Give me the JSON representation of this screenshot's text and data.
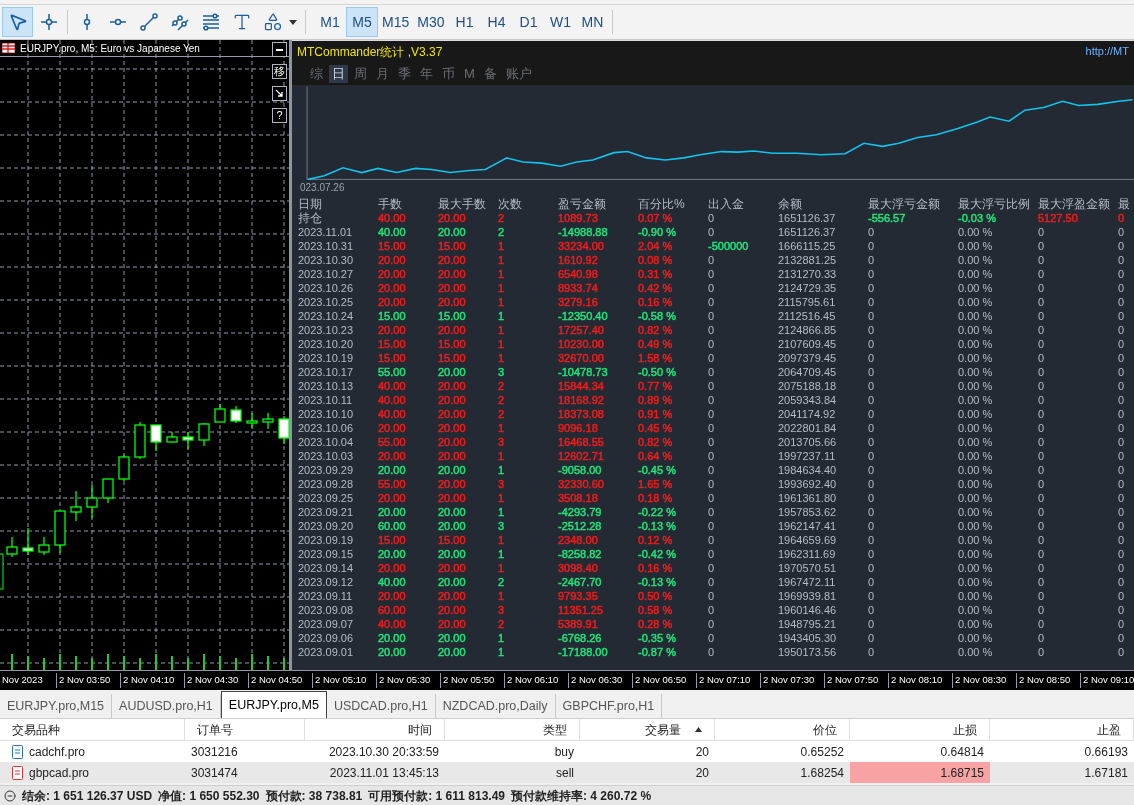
{
  "toolbar": {
    "drawing_tools": [
      {
        "kind": "cursor",
        "selected": true
      },
      {
        "kind": "crosshair",
        "selected": false
      },
      {
        "kind": "vertical_line",
        "selected": false
      },
      {
        "kind": "horizontal_line",
        "selected": false
      },
      {
        "kind": "trendline",
        "selected": false
      },
      {
        "kind": "channel",
        "selected": false
      },
      {
        "kind": "fibonacci",
        "selected": false
      },
      {
        "kind": "text",
        "selected": false
      },
      {
        "kind": "shapes",
        "selected": false
      }
    ],
    "timeframes": [
      {
        "label": "M1",
        "selected": false
      },
      {
        "label": "M5",
        "selected": true
      },
      {
        "label": "M15",
        "selected": false
      },
      {
        "label": "M30",
        "selected": false
      },
      {
        "label": "H1",
        "selected": false
      },
      {
        "label": "H4",
        "selected": false
      },
      {
        "label": "D1",
        "selected": false
      },
      {
        "label": "W1",
        "selected": false
      },
      {
        "label": "MN",
        "selected": false
      }
    ]
  },
  "chart_window": {
    "title": "EURJPY.pro, M5:  Euro vs Japanese Yen",
    "side_buttons": [
      {
        "kind": "minimize"
      },
      {
        "kind": "text",
        "label": "移"
      },
      {
        "kind": "arrow"
      },
      {
        "kind": "text",
        "label": "?"
      }
    ]
  },
  "commander": {
    "title": "MTCommander统计 ,V3.37",
    "link": "http://MT",
    "periods": [
      {
        "label": "综",
        "selected": false
      },
      {
        "label": "日",
        "selected": true
      },
      {
        "label": "周",
        "selected": false
      },
      {
        "label": "月",
        "selected": false
      },
      {
        "label": "季",
        "selected": false
      },
      {
        "label": "年",
        "selected": false
      },
      {
        "label": "币",
        "selected": false
      },
      {
        "label": "M",
        "selected": false
      },
      {
        "label": "备",
        "selected": false
      },
      {
        "label": "账户",
        "selected": false
      }
    ],
    "equity_chart": {
      "start_label": "023.07.26"
    },
    "columns": [
      "日期",
      "手数",
      "最大手数",
      "次数",
      "盈亏金额",
      "百分比%",
      "出入金",
      "余额",
      "最大浮亏金额",
      "最大浮亏比例",
      "最大浮盈金额",
      "最"
    ],
    "rows": [
      {
        "date": "持仓",
        "lots": "40.00",
        "max_lots": "20.00",
        "count": "2",
        "pnl": "1089.73",
        "pct": "0.07 %",
        "flow": "0",
        "balance": "1651126.37",
        "max_float_loss": {
          "text": "-556.57",
          "color": "#1ee37a"
        },
        "max_float_loss_pct": {
          "text": "-0.03 %",
          "color": "#1ee37a"
        },
        "max_float_profit": {
          "text": "5127.50",
          "color": "#f01c1c"
        },
        "column_12": {
          "text": "0",
          "color": "#f01c1c"
        },
        "color": "#f01c1c"
      },
      {
        "date": "2023.11.01",
        "lots": "40.00",
        "max_lots": "20.00",
        "count": "2",
        "pnl": "-14988.88",
        "pct": "-0.90 %",
        "flow": "0",
        "balance": "1651126.37",
        "max_float_loss": "0",
        "max_float_loss_pct": "0.00 %",
        "max_float_profit": "0",
        "column_12": "0",
        "color": "#1ee37a"
      },
      {
        "date": "2023.10.31",
        "lots": "15.00",
        "max_lots": "15.00",
        "count": "1",
        "pnl": "33234.00",
        "pct": "2.04 %",
        "flow": {
          "text": "-500000",
          "color": "#1ee37a"
        },
        "balance": "1666115.25",
        "max_float_loss": "0",
        "max_float_loss_pct": "0.00 %",
        "max_float_profit": "0",
        "column_12": "0",
        "color": "#f01c1c"
      },
      {
        "date": "2023.10.30",
        "lots": "20.00",
        "max_lots": "20.00",
        "count": "1",
        "pnl": "1610.92",
        "pct": "0.08 %",
        "flow": "0",
        "balance": "2132881.25",
        "max_float_loss": "0",
        "max_float_loss_pct": "0.00 %",
        "max_float_profit": "0",
        "column_12": "0",
        "color": "#f01c1c"
      },
      {
        "date": "2023.10.27",
        "lots": "20.00",
        "max_lots": "20.00",
        "count": "1",
        "pnl": "6540.98",
        "pct": "0.31 %",
        "flow": "0",
        "balance": "2131270.33",
        "max_float_loss": "0",
        "max_float_loss_pct": "0.00 %",
        "max_float_profit": "0",
        "column_12": "0",
        "color": "#f01c1c"
      },
      {
        "date": "2023.10.26",
        "lots": "20.00",
        "max_lots": "20.00",
        "count": "1",
        "pnl": "8933.74",
        "pct": "0.42 %",
        "flow": "0",
        "balance": "2124729.35",
        "max_float_loss": "0",
        "max_float_loss_pct": "0.00 %",
        "max_float_profit": "0",
        "column_12": "0",
        "color": "#f01c1c"
      },
      {
        "date": "2023.10.25",
        "lots": "20.00",
        "max_lots": "20.00",
        "count": "1",
        "pnl": "3279.16",
        "pct": "0.16 %",
        "flow": "0",
        "balance": "2115795.61",
        "max_float_loss": "0",
        "max_float_loss_pct": "0.00 %",
        "max_float_profit": "0",
        "column_12": "0",
        "color": "#f01c1c"
      },
      {
        "date": "2023.10.24",
        "lots": "15.00",
        "max_lots": "15.00",
        "count": "1",
        "pnl": "-12350.40",
        "pct": "-0.58 %",
        "flow": "0",
        "balance": "2112516.45",
        "max_float_loss": "0",
        "max_float_loss_pct": "0.00 %",
        "max_float_profit": "0",
        "column_12": "0",
        "color": "#1ee37a"
      },
      {
        "date": "2023.10.23",
        "lots": "20.00",
        "max_lots": "20.00",
        "count": "1",
        "pnl": "17257.40",
        "pct": "0.82 %",
        "flow": "0",
        "balance": "2124866.85",
        "max_float_loss": "0",
        "max_float_loss_pct": "0.00 %",
        "max_float_profit": "0",
        "column_12": "0",
        "color": "#f01c1c"
      },
      {
        "date": "2023.10.20",
        "lots": "15.00",
        "max_lots": "15.00",
        "count": "1",
        "pnl": "10230.00",
        "pct": "0.49 %",
        "flow": "0",
        "balance": "2107609.45",
        "max_float_loss": "0",
        "max_float_loss_pct": "0.00 %",
        "max_float_profit": "0",
        "column_12": "0",
        "color": "#f01c1c"
      },
      {
        "date": "2023.10.19",
        "lots": "15.00",
        "max_lots": "15.00",
        "count": "1",
        "pnl": "32670.00",
        "pct": "1.58 %",
        "flow": "0",
        "balance": "2097379.45",
        "max_float_loss": "0",
        "max_float_loss_pct": "0.00 %",
        "max_float_profit": "0",
        "column_12": "0",
        "color": "#f01c1c"
      },
      {
        "date": "2023.10.17",
        "lots": "55.00",
        "max_lots": "20.00",
        "count": "3",
        "pnl": "-10478.73",
        "pct": "-0.50 %",
        "flow": "0",
        "balance": "2064709.45",
        "max_float_loss": "0",
        "max_float_loss_pct": "0.00 %",
        "max_float_profit": "0",
        "column_12": "0",
        "color": "#1ee37a"
      },
      {
        "date": "2023.10.13",
        "lots": "40.00",
        "max_lots": "20.00",
        "count": "2",
        "pnl": "15844.34",
        "pct": "0.77 %",
        "flow": "0",
        "balance": "2075188.18",
        "max_float_loss": "0",
        "max_float_loss_pct": "0.00 %",
        "max_float_profit": "0",
        "column_12": "0",
        "color": "#f01c1c"
      },
      {
        "date": "2023.10.11",
        "lots": "40.00",
        "max_lots": "20.00",
        "count": "2",
        "pnl": "18168.92",
        "pct": "0.89 %",
        "flow": "0",
        "balance": "2059343.84",
        "max_float_loss": "0",
        "max_float_loss_pct": "0.00 %",
        "max_float_profit": "0",
        "column_12": "0",
        "color": "#f01c1c"
      },
      {
        "date": "2023.10.10",
        "lots": "40.00",
        "max_lots": "20.00",
        "count": "2",
        "pnl": "18373.08",
        "pct": "0.91 %",
        "flow": "0",
        "balance": "2041174.92",
        "max_float_loss": "0",
        "max_float_loss_pct": "0.00 %",
        "max_float_profit": "0",
        "column_12": "0",
        "color": "#f01c1c"
      },
      {
        "date": "2023.10.06",
        "lots": "20.00",
        "max_lots": "20.00",
        "count": "1",
        "pnl": "9096.18",
        "pct": "0.45 %",
        "flow": "0",
        "balance": "2022801.84",
        "max_float_loss": "0",
        "max_float_loss_pct": "0.00 %",
        "max_float_profit": "0",
        "column_12": "0",
        "color": "#f01c1c"
      },
      {
        "date": "2023.10.04",
        "lots": "55.00",
        "max_lots": "20.00",
        "count": "3",
        "pnl": "16468.55",
        "pct": "0.82 %",
        "flow": "0",
        "balance": "2013705.66",
        "max_float_loss": "0",
        "max_float_loss_pct": "0.00 %",
        "max_float_profit": "0",
        "column_12": "0",
        "color": "#f01c1c"
      },
      {
        "date": "2023.10.03",
        "lots": "20.00",
        "max_lots": "20.00",
        "count": "1",
        "pnl": "12602.71",
        "pct": "0.64 %",
        "flow": "0",
        "balance": "1997237.11",
        "max_float_loss": "0",
        "max_float_loss_pct": "0.00 %",
        "max_float_profit": "0",
        "column_12": "0",
        "color": "#f01c1c"
      },
      {
        "date": "2023.09.29",
        "lots": "20.00",
        "max_lots": "20.00",
        "count": "1",
        "pnl": "-9058.00",
        "pct": "-0.45 %",
        "flow": "0",
        "balance": "1984634.40",
        "max_float_loss": "0",
        "max_float_loss_pct": "0.00 %",
        "max_float_profit": "0",
        "column_12": "0",
        "color": "#1ee37a"
      },
      {
        "date": "2023.09.28",
        "lots": "55.00",
        "max_lots": "20.00",
        "count": "3",
        "pnl": "32330.60",
        "pct": "1.65 %",
        "flow": "0",
        "balance": "1993692.40",
        "max_float_loss": "0",
        "max_float_loss_pct": "0.00 %",
        "max_float_profit": "0",
        "column_12": "0",
        "color": "#f01c1c"
      },
      {
        "date": "2023.09.25",
        "lots": "20.00",
        "max_lots": "20.00",
        "count": "1",
        "pnl": "3508.18",
        "pct": "0.18 %",
        "flow": "0",
        "balance": "1961361.80",
        "max_float_loss": "0",
        "max_float_loss_pct": "0.00 %",
        "max_float_profit": "0",
        "column_12": "0",
        "color": "#f01c1c"
      },
      {
        "date": "2023.09.21",
        "lots": "20.00",
        "max_lots": "20.00",
        "count": "1",
        "pnl": "-4293.79",
        "pct": "-0.22 %",
        "flow": "0",
        "balance": "1957853.62",
        "max_float_loss": "0",
        "max_float_loss_pct": "0.00 %",
        "max_float_profit": "0",
        "column_12": "0",
        "color": "#1ee37a"
      },
      {
        "date": "2023.09.20",
        "lots": "60.00",
        "max_lots": "20.00",
        "count": "3",
        "pnl": "-2512.28",
        "pct": "-0.13 %",
        "flow": "0",
        "balance": "1962147.41",
        "max_float_loss": "0",
        "max_float_loss_pct": "0.00 %",
        "max_float_profit": "0",
        "column_12": "0",
        "color": "#1ee37a"
      },
      {
        "date": "2023.09.19",
        "lots": "15.00",
        "max_lots": "15.00",
        "count": "1",
        "pnl": "2348.00",
        "pct": "0.12 %",
        "flow": "0",
        "balance": "1964659.69",
        "max_float_loss": "0",
        "max_float_loss_pct": "0.00 %",
        "max_float_profit": "0",
        "column_12": "0",
        "color": "#f01c1c"
      },
      {
        "date": "2023.09.15",
        "lots": "20.00",
        "max_lots": "20.00",
        "count": "1",
        "pnl": "-8258.82",
        "pct": "-0.42 %",
        "flow": "0",
        "balance": "1962311.69",
        "max_float_loss": "0",
        "max_float_loss_pct": "0.00 %",
        "max_float_profit": "0",
        "column_12": "0",
        "color": "#1ee37a"
      },
      {
        "date": "2023.09.14",
        "lots": "20.00",
        "max_lots": "20.00",
        "count": "1",
        "pnl": "3098.40",
        "pct": "0.16 %",
        "flow": "0",
        "balance": "1970570.51",
        "max_float_loss": "0",
        "max_float_loss_pct": "0.00 %",
        "max_float_profit": "0",
        "column_12": "0",
        "color": "#f01c1c"
      },
      {
        "date": "2023.09.12",
        "lots": "40.00",
        "max_lots": "20.00",
        "count": "2",
        "pnl": "-2467.70",
        "pct": "-0.13 %",
        "flow": "0",
        "balance": "1967472.11",
        "max_float_loss": "0",
        "max_float_loss_pct": "0.00 %",
        "max_float_profit": "0",
        "column_12": "0",
        "color": "#1ee37a"
      },
      {
        "date": "2023.09.11",
        "lots": "20.00",
        "max_lots": "20.00",
        "count": "1",
        "pnl": "9793.35",
        "pct": "0.50 %",
        "flow": "0",
        "balance": "1969939.81",
        "max_float_loss": "0",
        "max_float_loss_pct": "0.00 %",
        "max_float_profit": "0",
        "column_12": "0",
        "color": "#f01c1c"
      },
      {
        "date": "2023.09.08",
        "lots": "60.00",
        "max_lots": "20.00",
        "count": "3",
        "pnl": "11351.25",
        "pct": "0.58 %",
        "flow": "0",
        "balance": "1960146.46",
        "max_float_loss": "0",
        "max_float_loss_pct": "0.00 %",
        "max_float_profit": "0",
        "column_12": "0",
        "color": "#f01c1c"
      },
      {
        "date": "2023.09.07",
        "lots": "40.00",
        "max_lots": "20.00",
        "count": "2",
        "pnl": "5389.91",
        "pct": "0.28 %",
        "flow": "0",
        "balance": "1948795.21",
        "max_float_loss": "0",
        "max_float_loss_pct": "0.00 %",
        "max_float_profit": "0",
        "column_12": "0",
        "color": "#f01c1c"
      },
      {
        "date": "2023.09.06",
        "lots": "20.00",
        "max_lots": "20.00",
        "count": "1",
        "pnl": "-6768.26",
        "pct": "-0.35 %",
        "flow": "0",
        "balance": "1943405.30",
        "max_float_loss": "0",
        "max_float_loss_pct": "0.00 %",
        "max_float_profit": "0",
        "column_12": "0",
        "color": "#1ee37a"
      },
      {
        "date": "2023.09.01",
        "lots": "20.00",
        "max_lots": "20.00",
        "count": "1",
        "pnl": "-17188.00",
        "pct": "-0.87 %",
        "flow": "0",
        "balance": "1950173.56",
        "max_float_loss": "0",
        "max_float_loss_pct": "0.00 %",
        "max_float_profit": "0",
        "column_12": "0",
        "color": "#1ee37a"
      }
    ]
  },
  "time_axis": [
    "Nov 2023",
    "2 Nov 03:50",
    "2 Nov 04:10",
    "2 Nov 04:30",
    "2 Nov 04:50",
    "2 Nov 05:10",
    "2 Nov 05:30",
    "2 Nov 05:50",
    "2 Nov 06:10",
    "2 Nov 06:30",
    "2 Nov 06:50",
    "2 Nov 07:10",
    "2 Nov 07:30",
    "2 Nov 07:50",
    "2 Nov 08:10",
    "2 Nov 08:30",
    "2 Nov 08:50",
    "2 Nov 09:10"
  ],
  "chart_tabs": [
    {
      "label": "EURJPY.pro,M15",
      "selected": false
    },
    {
      "label": "AUDUSD.pro,H1",
      "selected": false
    },
    {
      "label": "EURJPY.pro,M5",
      "selected": true
    },
    {
      "label": "USDCAD.pro,H1",
      "selected": false
    },
    {
      "label": "NZDCAD.pro,Daily",
      "selected": false
    },
    {
      "label": "GBPCHF.pro,H1",
      "selected": false
    }
  ],
  "trades": {
    "columns": [
      {
        "label": "交易品种",
        "sorted": false
      },
      {
        "label": "订单号",
        "sorted": false
      },
      {
        "label": "时间",
        "sorted": false
      },
      {
        "label": "类型",
        "sorted": false
      },
      {
        "label": "交易量",
        "sorted": true
      },
      {
        "label": "价位",
        "sorted": false
      },
      {
        "label": "止损",
        "sorted": false
      },
      {
        "label": "止盈",
        "sorted": false
      }
    ],
    "rows": [
      {
        "symbol": "cadchf.pro",
        "order": "3031216",
        "time": "2023.10.30 20:33:59",
        "type": "buy",
        "volume": "20",
        "price": "0.65252",
        "sl": "0.64814",
        "tp": "0.66193",
        "kind": "buy",
        "selected": false,
        "sl_alert": false
      },
      {
        "symbol": "gbpcad.pro",
        "order": "3031474",
        "time": "2023.11.01 13:45:13",
        "type": "sell",
        "volume": "20",
        "price": "1.68254",
        "sl": "1.68715",
        "tp": "1.67181",
        "kind": "sell",
        "selected": true,
        "sl_alert": true
      }
    ]
  },
  "status_bar": {
    "items": [
      {
        "label": "结余:",
        "value": "1 651 126.37 USD"
      },
      {
        "label": "净值:",
        "value": "1 650 552.30"
      },
      {
        "label": "预付款:",
        "value": "38 738.81"
      },
      {
        "label": "可用预付款:",
        "value": "1 611 813.49"
      },
      {
        "label": "预付款维持率:",
        "value": "4 260.72 %"
      }
    ]
  }
}
